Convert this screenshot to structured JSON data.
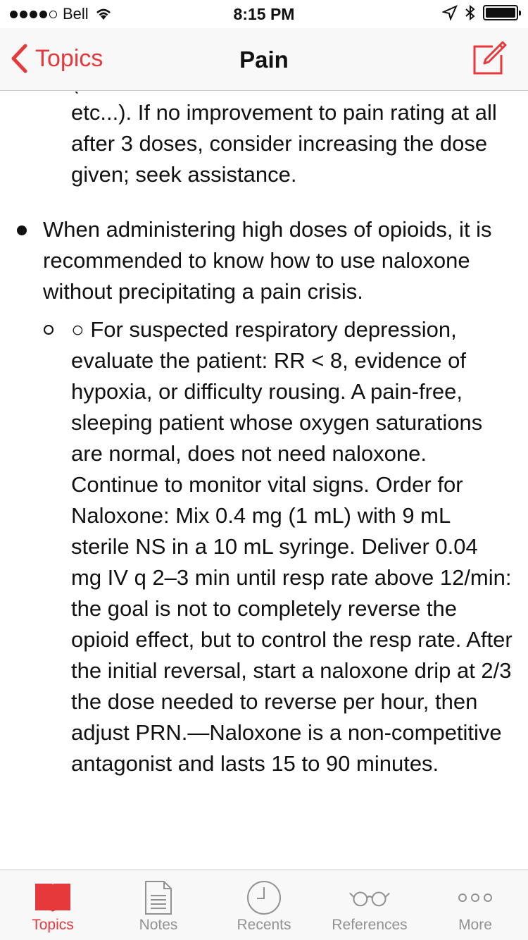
{
  "status_bar": {
    "carrier": "Bell",
    "time": "8:15 PM"
  },
  "nav": {
    "back_label": "Topics",
    "title": "Pain"
  },
  "content": {
    "partial_first_line": "(drowsiness, nausea, delirium/confusion,",
    "continued_text": "etc...). If no improvement to pain rating at all after 3 doses, consider increasing the dose given; seek assistance.",
    "bullet_text": "When administering high doses of opioids, it is recommended to know how to use naloxone without precipitating a pain crisis.",
    "sub_bullet_text": "○ For suspected respiratory depression, evaluate the patient: RR < 8, evidence of hypoxia, or difficulty rousing. A pain-free, sleeping patient whose oxygen saturations are normal, does not need naloxone. Continue to monitor vital signs. Order for Naloxone: Mix 0.4 mg (1 mL) with 9 mL sterile NS in a 10 mL syringe. Deliver 0.04 mg IV q 2–3 min until resp rate above 12/min: the goal is not to completely reverse the opioid effect, but to control the resp rate. After the initial reversal, start a naloxone drip at 2/3 the dose needed to reverse per hour, then adjust PRN.—Naloxone is a non-competitive antagonist and lasts 15 to 90 minutes."
  },
  "tabs": [
    {
      "label": "Topics",
      "icon": "book-icon",
      "active": true
    },
    {
      "label": "Notes",
      "icon": "document-icon",
      "active": false
    },
    {
      "label": "Recents",
      "icon": "clock-icon",
      "active": false
    },
    {
      "label": "References",
      "icon": "glasses-icon",
      "active": false
    },
    {
      "label": "More",
      "icon": "more-icon",
      "active": false
    }
  ],
  "colors": {
    "accent": "#e5393c",
    "tab_inactive": "#929292",
    "bar_bg": "#f8f8f8"
  }
}
